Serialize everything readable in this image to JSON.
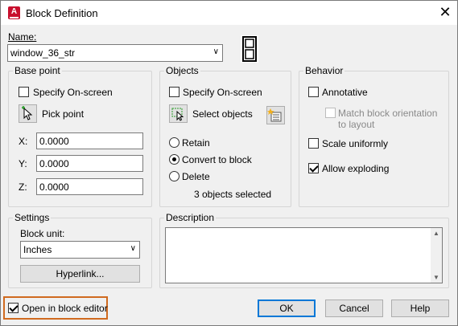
{
  "window": {
    "title": "Block Definition",
    "close_glyph": "✕",
    "app_icon_glyph": "A"
  },
  "name": {
    "label": "Name:",
    "value": "window_36_str"
  },
  "base_point": {
    "title": "Base point",
    "specify_onscreen": "Specify On-screen",
    "pick_point": "Pick point",
    "x_label": "X:",
    "x_value": "0.0000",
    "y_label": "Y:",
    "y_value": "0.0000",
    "z_label": "Z:",
    "z_value": "0.0000"
  },
  "objects": {
    "title": "Objects",
    "specify_onscreen": "Specify On-screen",
    "select_objects": "Select objects",
    "retain": "Retain",
    "convert_to_block": "Convert to block",
    "delete": "Delete",
    "status": "3 objects selected"
  },
  "behavior": {
    "title": "Behavior",
    "annotative": "Annotative",
    "match_orientation_line1": "Match block orientation",
    "match_orientation_line2": "to layout",
    "scale_uniformly": "Scale uniformly",
    "allow_exploding": "Allow exploding"
  },
  "settings": {
    "title": "Settings",
    "block_unit_label": "Block unit:",
    "block_unit_value": "Inches",
    "hyperlink_button": "Hyperlink..."
  },
  "description": {
    "title": "Description",
    "value": ""
  },
  "footer": {
    "open_in_editor": "Open in block editor",
    "ok": "OK",
    "cancel": "Cancel",
    "help": "Help"
  },
  "colors": {
    "highlight": "#d06a1f",
    "default_button_border": "#0078d7",
    "app_icon": "#c8102e"
  }
}
